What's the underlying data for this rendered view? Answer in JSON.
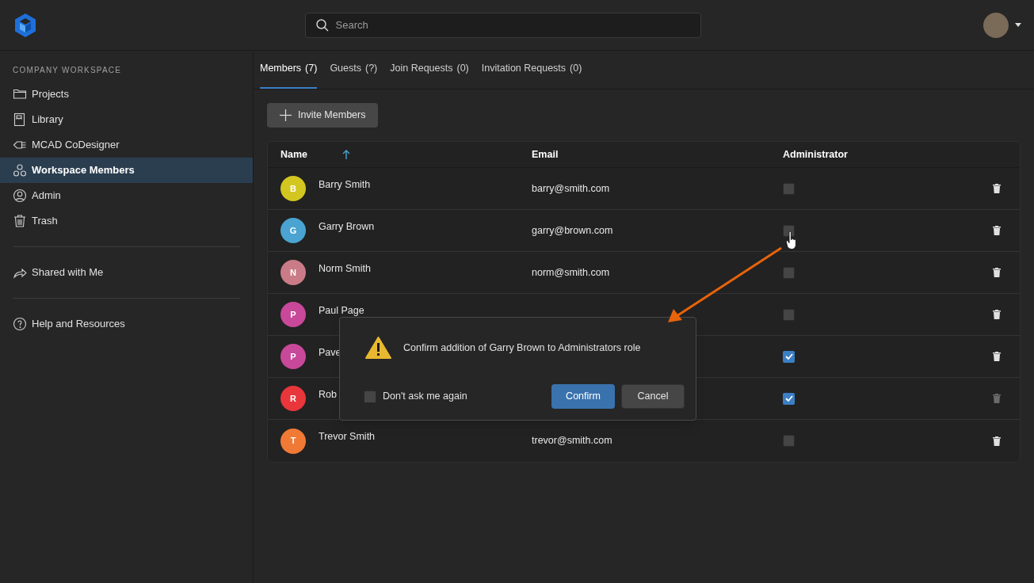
{
  "header": {
    "search": {
      "placeholder": "Search"
    }
  },
  "sidebar": {
    "section_title": "COMPANY WORKSPACE",
    "groups": [
      [
        {
          "label": "Projects",
          "selected": false
        },
        {
          "label": "Library",
          "selected": false
        },
        {
          "label": "MCAD CoDesigner",
          "selected": false
        },
        {
          "label": "Workspace Members",
          "selected": true
        },
        {
          "label": "Admin",
          "selected": false
        },
        {
          "label": "Trash",
          "selected": false
        }
      ],
      [
        {
          "label": "Shared with Me",
          "selected": false
        }
      ],
      [
        {
          "label": "Help and Resources",
          "selected": false
        }
      ]
    ]
  },
  "tabs": [
    {
      "label": "Members",
      "count": "(7)",
      "selected": true
    },
    {
      "label": "Guests",
      "count": "(?)",
      "selected": false
    },
    {
      "label": "Join Requests",
      "count": "(0)",
      "selected": false
    },
    {
      "label": "Invitation Requests",
      "count": "(0)",
      "selected": false
    }
  ],
  "invite_button": "Invite Members",
  "table": {
    "columns": [
      {
        "label": "Name",
        "sorted": true
      },
      {
        "label": "Email",
        "sorted": false
      },
      {
        "label": "Administrator",
        "sorted": false
      }
    ],
    "rows": [
      {
        "initial": "B",
        "color": "#d4c620",
        "name": "Barry Smith",
        "email": "barry@smith.com",
        "administrator": false,
        "delete_disabled": false
      },
      {
        "initial": "G",
        "color": "#4aa3d0",
        "name": "Garry Brown",
        "email": "garry@brown.com",
        "administrator": false,
        "delete_disabled": false
      },
      {
        "initial": "N",
        "color": "#c97b87",
        "name": "Norm Smith",
        "email": "norm@smith.com",
        "administrator": false,
        "delete_disabled": false
      },
      {
        "initial": "P",
        "color": "#c8489a",
        "name": "Paul Page",
        "administrator": false,
        "delete_disabled": false
      },
      {
        "initial": "P",
        "color": "#c8489a",
        "name": "Pave",
        "administrator": true,
        "delete_disabled": false
      },
      {
        "initial": "R",
        "color": "#e8363b",
        "name": "Rob",
        "administrator": true,
        "delete_disabled": true
      },
      {
        "initial": "T",
        "color": "#f07a35",
        "name": "Trevor Smith",
        "email": "trevor@smith.com",
        "administrator": false,
        "delete_disabled": false
      }
    ]
  },
  "dialog": {
    "message": "Confirm addition of Garry Brown to Administrators role",
    "dont_ask": {
      "label": "Don't ask me again",
      "checked": false
    },
    "buttons": [
      "Confirm",
      "Cancel"
    ]
  }
}
